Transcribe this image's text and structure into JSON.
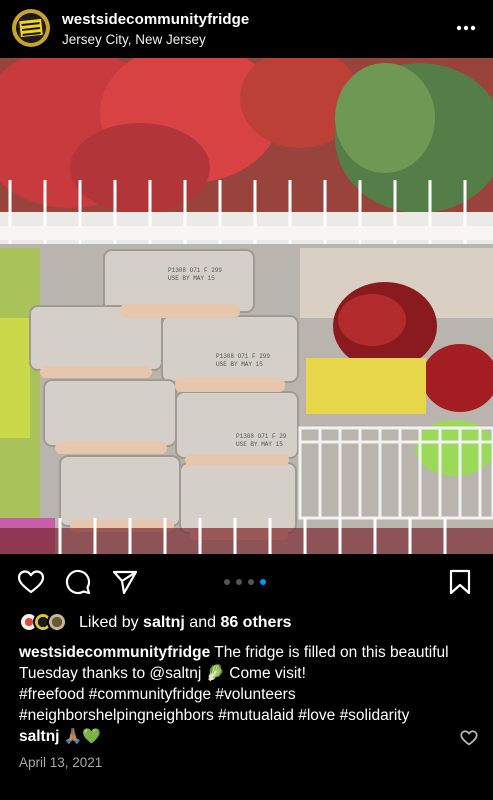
{
  "post": {
    "username": "westsidecommunityfridge",
    "location": "Jersey City, New Jersey",
    "more_icon": "more-horizontal-icon",
    "photo_alt": "Community fridge shelves with egg cartons and produce",
    "egg_label_1": "P1308 O71 F 299\nUSE BY MAY 15",
    "egg_label_2": "P1308 O71 F 299\nUSE BY MAY 15",
    "egg_label_3": "P1308 O71 F 29\nUSE BY MAY 15"
  },
  "actions": {
    "like_icon": "heart-icon",
    "comment_icon": "comment-icon",
    "share_icon": "send-icon",
    "save_icon": "bookmark-icon",
    "carousel_count": 4,
    "carousel_active": 3
  },
  "likes": {
    "prefix": "Liked by ",
    "liker": "saltnj",
    "middle": " and ",
    "others": "86 others"
  },
  "caption": {
    "username": "westsidecommunityfridge",
    "text_1": " The fridge is filled on this beautiful Tuesday thanks to @saltnj ",
    "emoji_1": "🥬",
    "text_2": " Come visit!",
    "hashtags": "#freefood #communityfridge #volunteers #neighborshelpingneighbors #mutualaid #love #solidarity"
  },
  "comment": {
    "username": "saltnj",
    "emoji": "🙏🏽💚",
    "like_icon": "heart-outline-icon"
  },
  "date": "April 13, 2021",
  "colors": {
    "background": "#000000",
    "text": "#ffffff",
    "muted": "#a8a8a8",
    "carousel_active": "#0095f6",
    "carousel_inactive": "#555555"
  }
}
